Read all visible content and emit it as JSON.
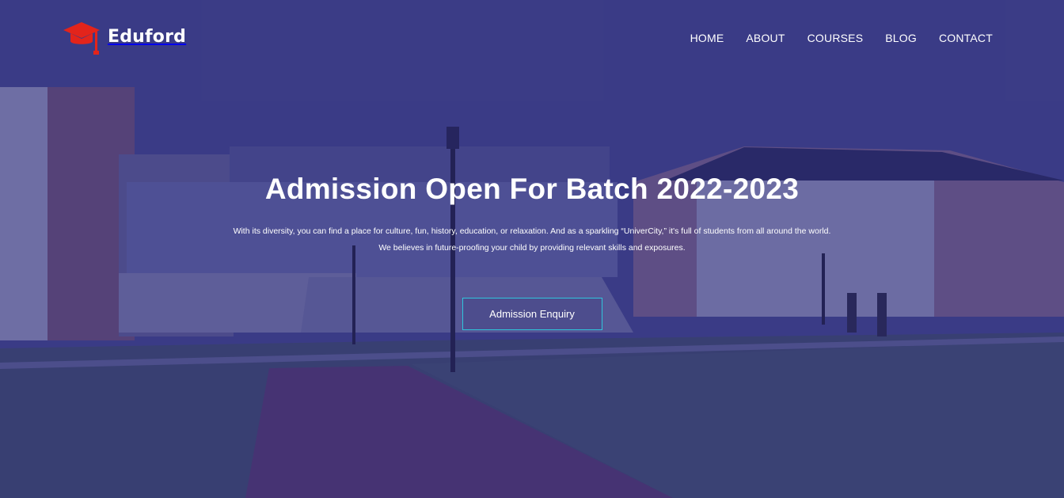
{
  "brand": {
    "name": "Eduford",
    "icon": "graduation-cap-icon",
    "icon_color": "#e3241b"
  },
  "nav": {
    "items": [
      "HOME",
      "ABOUT",
      "COURSES",
      "BLOG",
      "CONTACT"
    ]
  },
  "hero": {
    "title": "Admission Open For Batch 2022-2023",
    "text_line1": "With its diversity, you can find a place for culture, fun, history, education, or relaxation. And as a sparkling “UniverCity,” it's full of students from all around the world.",
    "text_line2": "We believes in future-proofing your child by providing relevant skills and exposures.",
    "cta_label": "Admission Enquiry",
    "cta_border_color": "#2fc4dc"
  },
  "colors": {
    "overlay": "#3b3f86",
    "text": "#ffffff"
  }
}
